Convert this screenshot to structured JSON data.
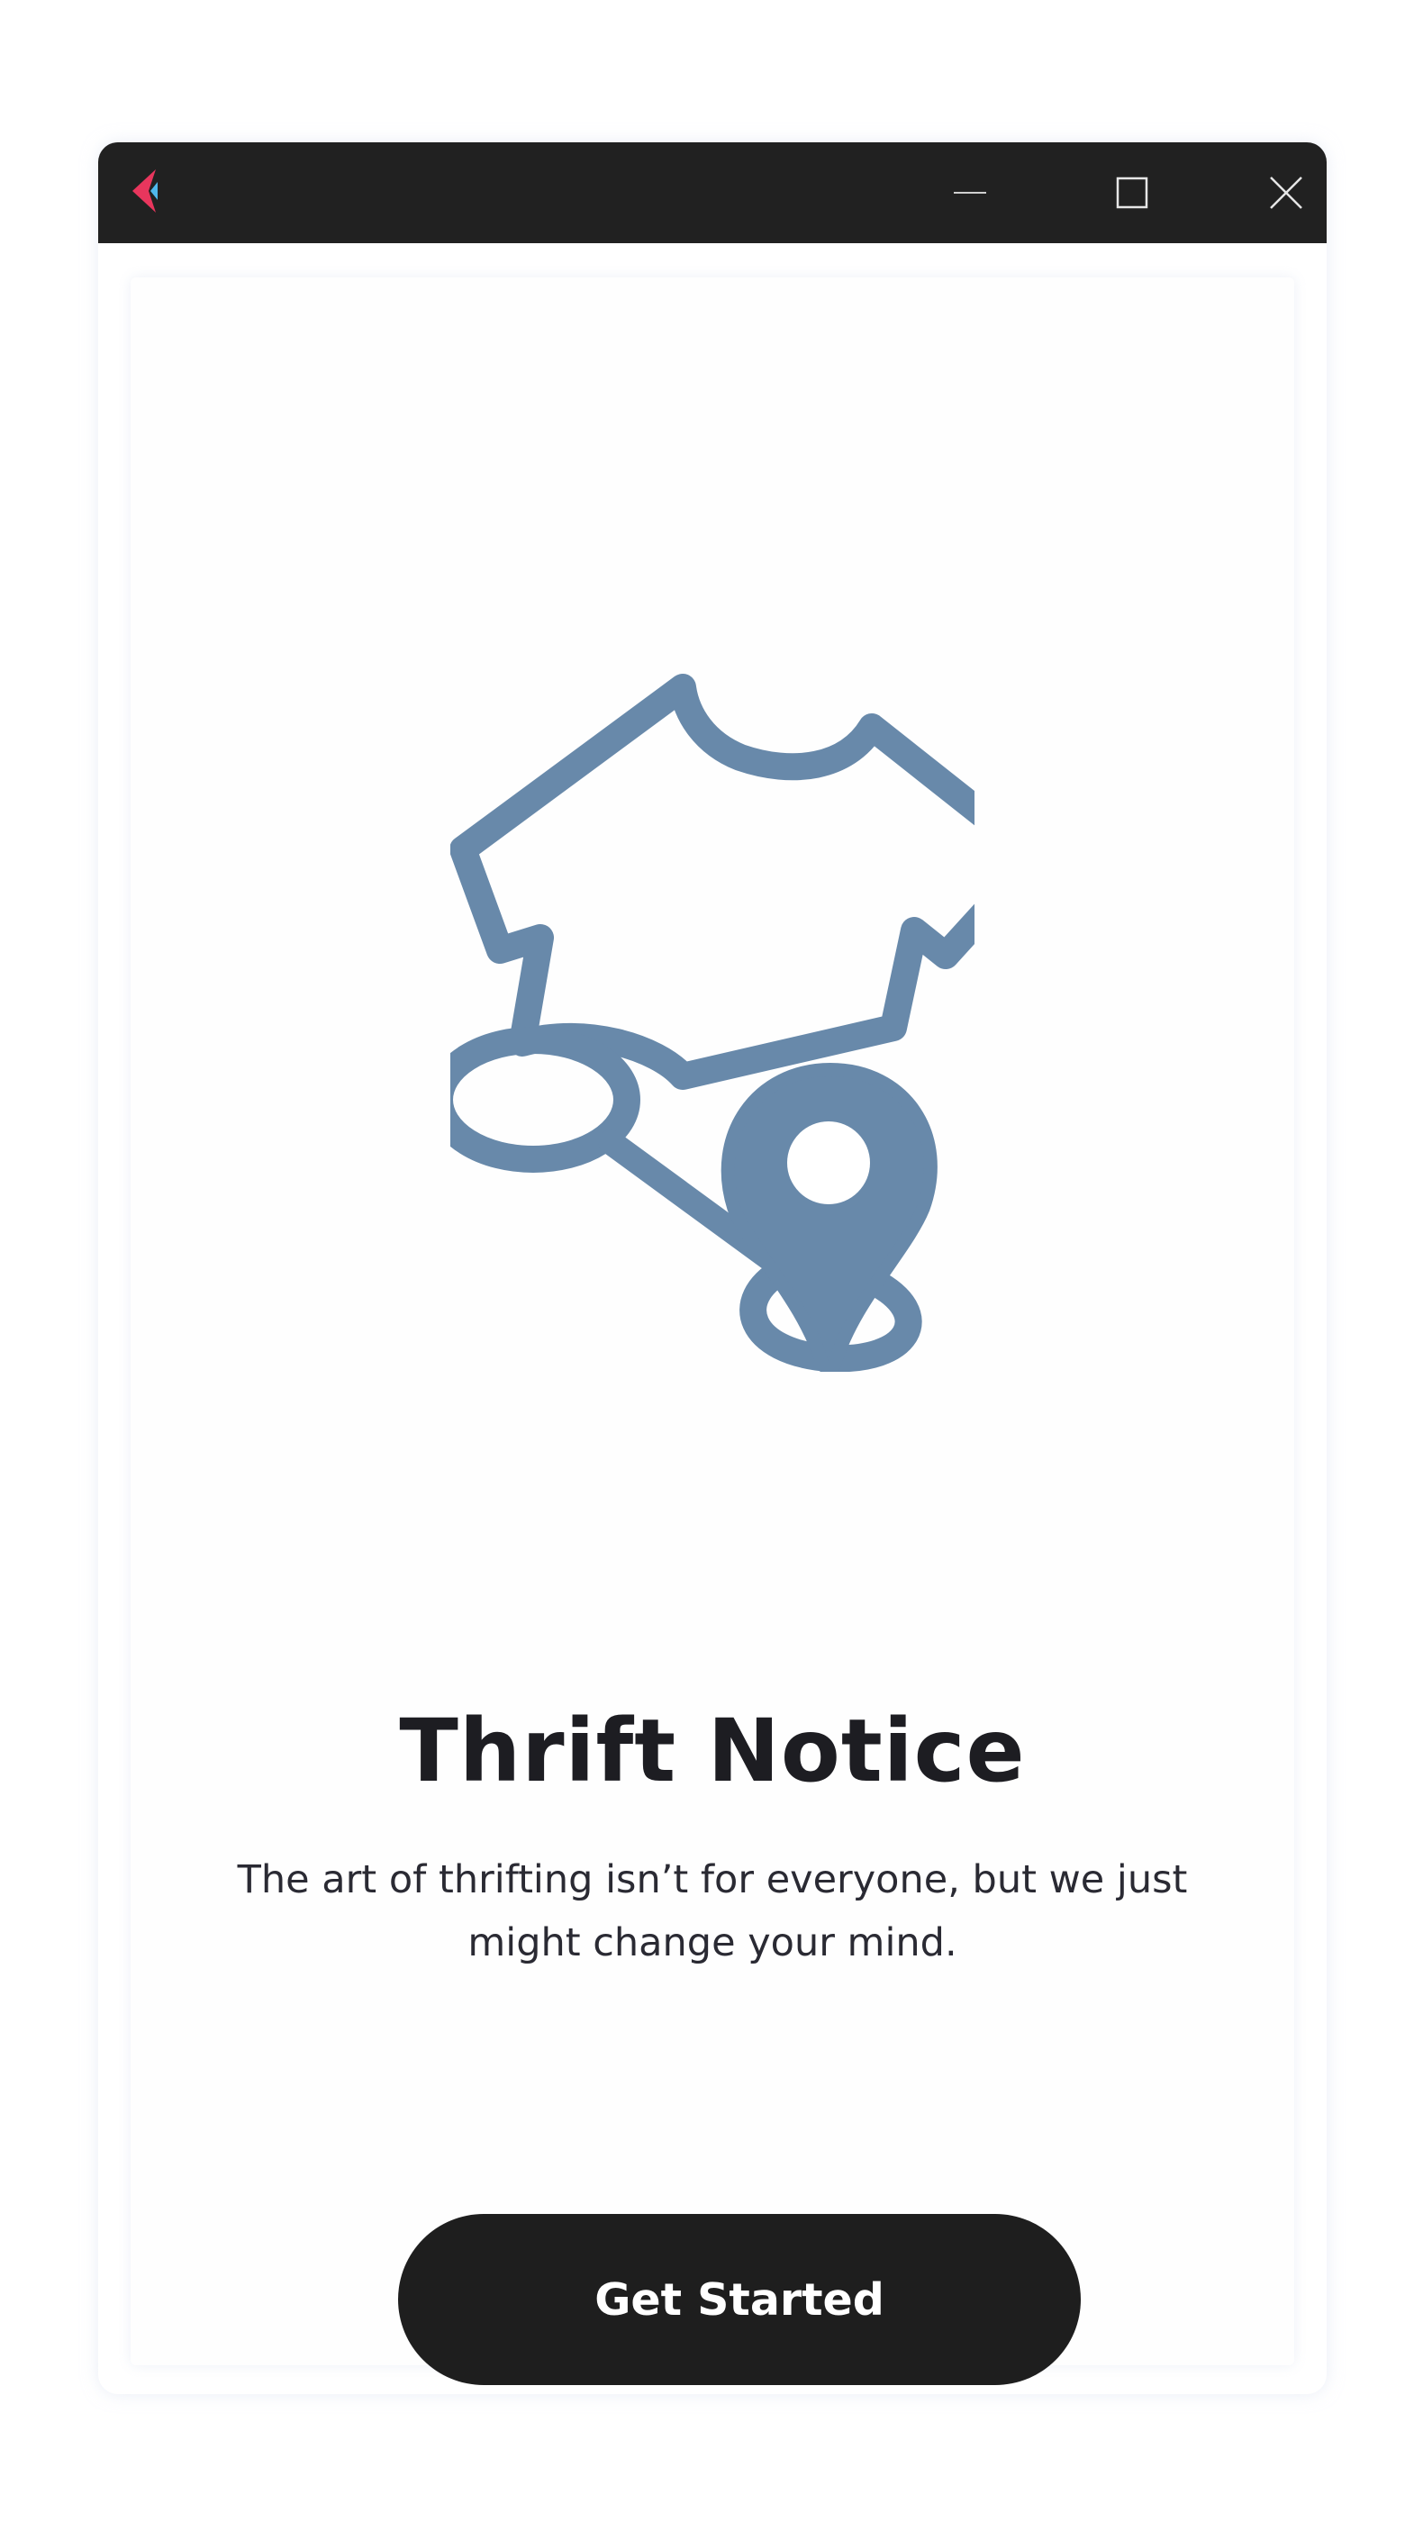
{
  "window": {
    "colors": {
      "titlebar": "#212121",
      "icon_primary": "#e8365d",
      "icon_secondary": "#4fb8ec",
      "illustration": "#6889aa",
      "button_bg": "#1e1e1e"
    },
    "controls": {
      "minimize_icon": "minimize-icon",
      "maximize_icon": "maximize-icon",
      "close_icon": "close-icon"
    }
  },
  "onboarding": {
    "illustration_icon": "thrift-shirt-location-icon",
    "title": "Thrift Notice",
    "subtitle": "The art of thrifting isn’t for everyone, but we just might change your mind.",
    "cta_label": "Get Started"
  }
}
